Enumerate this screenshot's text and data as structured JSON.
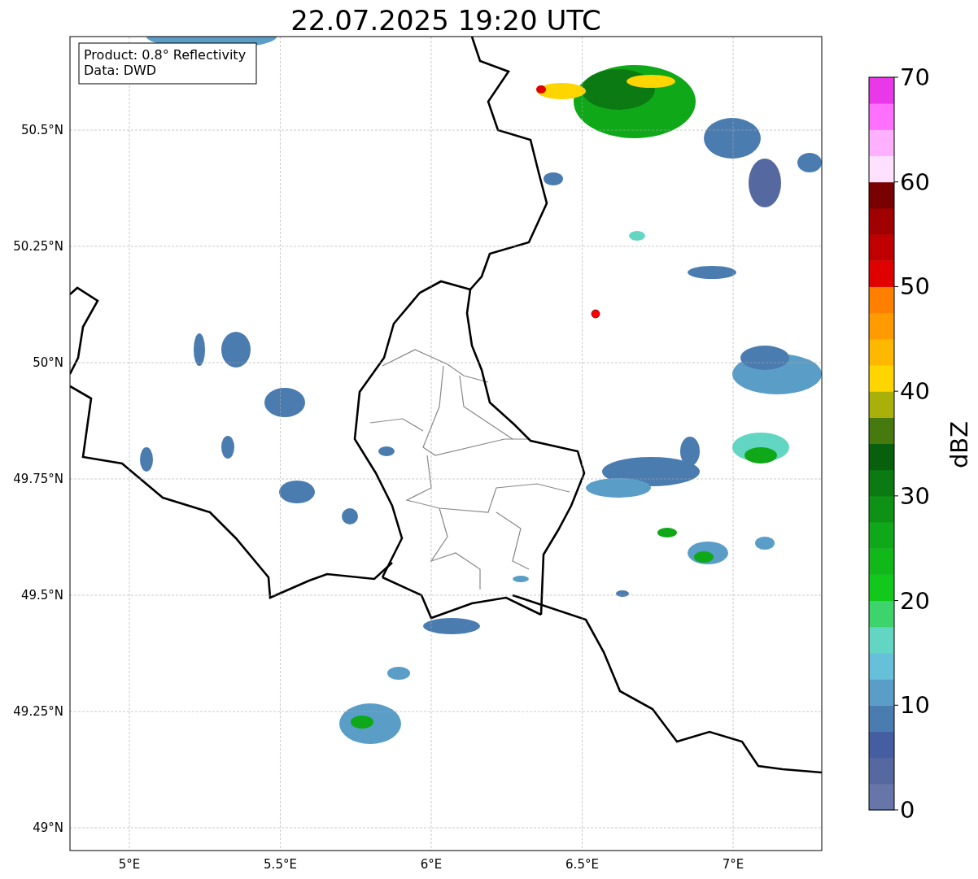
{
  "title": "22.07.2025 19:20 UTC",
  "info_box": {
    "lines": [
      "Product: 0.8° Reflectivity",
      "Data: DWD"
    ]
  },
  "map": {
    "x_ticks": [
      "5°E",
      "5.5°E",
      "6°E",
      "6.5°E",
      "7°E"
    ],
    "y_ticks": [
      "50.5°N",
      "50.25°N",
      "50°N",
      "49.75°N",
      "49.5°N",
      "49.25°N",
      "49°N"
    ]
  },
  "colorbar": {
    "label": "dBZ",
    "ticks": [
      "70",
      "60",
      "50",
      "40",
      "30",
      "20",
      "10",
      "0"
    ],
    "bins": [
      {
        "color": "#6676a8"
      },
      {
        "color": "#55689f"
      },
      {
        "color": "#445ea1"
      },
      {
        "color": "#4a7cb0"
      },
      {
        "color": "#5a9ec8"
      },
      {
        "color": "#66c0da"
      },
      {
        "color": "#62d6c2"
      },
      {
        "color": "#3dd46e"
      },
      {
        "color": "#12c81a"
      },
      {
        "color": "#10b81a"
      },
      {
        "color": "#0fa818"
      },
      {
        "color": "#0e9216"
      },
      {
        "color": "#0b7a12"
      },
      {
        "color": "#08600e"
      },
      {
        "color": "#467a0e"
      },
      {
        "color": "#aab00a"
      },
      {
        "color": "#ffd500"
      },
      {
        "color": "#ffb800"
      },
      {
        "color": "#ff9a00"
      },
      {
        "color": "#ff7f00"
      },
      {
        "color": "#e00000"
      },
      {
        "color": "#c00000"
      },
      {
        "color": "#a00000"
      },
      {
        "color": "#780000"
      },
      {
        "color": "#ffe0ff"
      },
      {
        "color": "#ffb0ff"
      },
      {
        "color": "#ff70ff"
      },
      {
        "color": "#e838e8"
      }
    ]
  }
}
